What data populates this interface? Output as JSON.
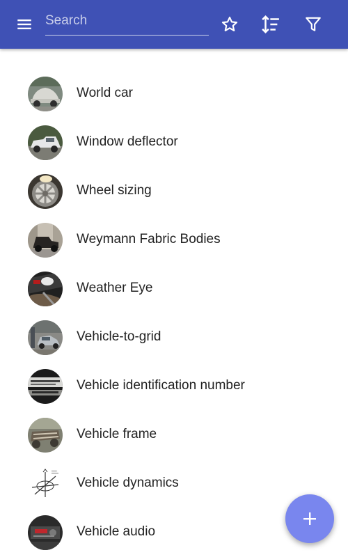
{
  "toolbar": {
    "menu_icon": "menu-icon",
    "search_placeholder": "Search",
    "search_value": "",
    "favorites_icon": "star-outline-icon",
    "sort_icon": "sort-icon",
    "filter_icon": "filter-icon",
    "color": "#3f51b5"
  },
  "list": {
    "items": [
      {
        "label": "World car",
        "thumbnail": "beetle-car-photo"
      },
      {
        "label": "Window deflector",
        "thumbnail": "pickup-truck-photo"
      },
      {
        "label": "Wheel sizing",
        "thumbnail": "wheel-rim-photo"
      },
      {
        "label": "Weymann Fabric Bodies",
        "thumbnail": "vintage-car-photo"
      },
      {
        "label": "Weather Eye",
        "thumbnail": "dashboard-control-photo"
      },
      {
        "label": "Vehicle-to-grid",
        "thumbnail": "electric-car-charging-photo"
      },
      {
        "label": "Vehicle identification number",
        "thumbnail": "vin-plate-photo"
      },
      {
        "label": "Vehicle frame",
        "thumbnail": "car-frame-photo"
      },
      {
        "label": "Vehicle dynamics",
        "thumbnail": "axes-diagram-drawing"
      },
      {
        "label": "Vehicle audio",
        "thumbnail": "car-radio-photo"
      }
    ]
  },
  "fab": {
    "icon": "plus-icon",
    "color": "#7986ee"
  }
}
